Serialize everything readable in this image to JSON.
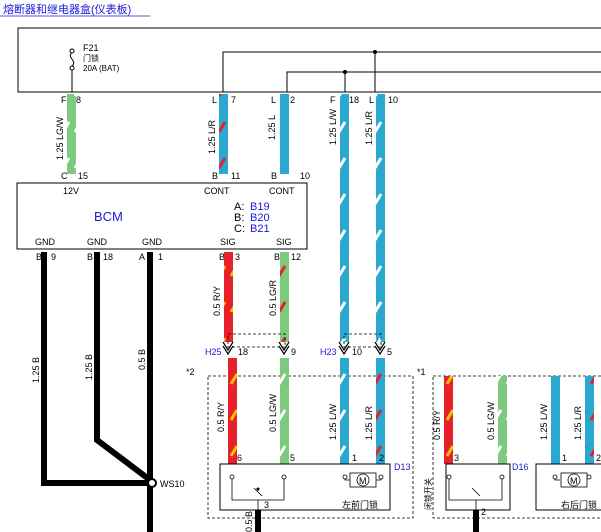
{
  "header": {
    "title": "熔断器和继电器盒(仪表板)"
  },
  "fuse": {
    "id": "F21",
    "name": "门锁",
    "rating": "20A (BAT)"
  },
  "connectors_top": [
    {
      "name": "conn-f8",
      "letter": "F",
      "pin": "8"
    },
    {
      "name": "conn-l7",
      "letter": "L",
      "pin": "7"
    },
    {
      "name": "conn-l2",
      "letter": "L",
      "pin": "2"
    },
    {
      "name": "conn-f18",
      "letter": "F",
      "pin": "18"
    },
    {
      "name": "conn-l10",
      "letter": "L",
      "pin": "10"
    }
  ],
  "wires_upper": [
    {
      "name": "wire-lgw-upper",
      "label": "1.25 LG/W",
      "color": "#7dc97d",
      "stripe": "#ffffff"
    },
    {
      "name": "wire-lr-upper",
      "label": "1.25 L/R",
      "color": "#2aa8d0",
      "stripe": "#e8202a"
    },
    {
      "name": "wire-l-upper",
      "label": "1.25 L",
      "color": "#2aa8d0",
      "stripe": ""
    },
    {
      "name": "wire-lw-upper",
      "label": "1.25 L/W",
      "color": "#2aa8d0",
      "stripe": "#ffffff"
    },
    {
      "name": "wire-lr2-upper",
      "label": "1.25 L/R",
      "color": "#2aa8d0",
      "stripe": "#ffffff"
    }
  ],
  "bcm": {
    "label": "BCM",
    "pin_12v": {
      "letter": "C",
      "pin": "15",
      "text": "12V"
    },
    "pin_cont1": {
      "letter": "B",
      "pin": "11",
      "text": "CONT"
    },
    "pin_cont2": {
      "letter": "B",
      "pin": "10",
      "text": "CONT"
    },
    "legend": [
      {
        "key": "A:",
        "val": "B19"
      },
      {
        "key": "B:",
        "val": "B20"
      },
      {
        "key": "C:",
        "val": "B21"
      }
    ],
    "bottom_pins": [
      {
        "name": "bcm-gnd-b9",
        "text": "GND",
        "letter": "B",
        "pin": "9"
      },
      {
        "name": "bcm-gnd-b18",
        "text": "GND",
        "letter": "B",
        "pin": "18"
      },
      {
        "name": "bcm-gnd-a1",
        "text": "GND",
        "letter": "A",
        "pin": "1"
      },
      {
        "name": "bcm-sig-b3",
        "text": "SIG",
        "letter": "B",
        "pin": "3"
      },
      {
        "name": "bcm-sig-b12",
        "text": "SIG",
        "letter": "B",
        "pin": "12"
      }
    ]
  },
  "wires_gnd": [
    {
      "name": "wire-gnd-1",
      "label": "1.25 B"
    },
    {
      "name": "wire-gnd-2",
      "label": "1.25 B"
    },
    {
      "name": "wire-gnd-3",
      "label": "0.5 B"
    }
  ],
  "wires_sig": [
    {
      "name": "wire-ry-mid",
      "label": "0.5 R/Y",
      "color": "#e8202a",
      "stripe": "#f5c400"
    },
    {
      "name": "wire-lgr-mid",
      "label": "0.5 LG/R",
      "color": "#7dc97d",
      "stripe": "#e8202a"
    }
  ],
  "inline_connectors": {
    "h25": {
      "id": "H25",
      "pins": [
        "18",
        "9"
      ]
    },
    "h23": {
      "id": "H23",
      "pins": [
        "10",
        "5"
      ]
    }
  },
  "ground_point": "WS10",
  "group2": {
    "marker": "*2",
    "wires": [
      {
        "name": "wire-g2-ry",
        "label": "0.5 R/Y",
        "color": "#e8202a",
        "stripe": "#f5c400"
      },
      {
        "name": "wire-g2-lgw",
        "label": "0.5 LG/W",
        "color": "#7dc97d",
        "stripe": "#ffffff"
      },
      {
        "name": "wire-g2-lw",
        "label": "1.25 L/W",
        "color": "#2aa8d0",
        "stripe": "#ffffff"
      },
      {
        "name": "wire-g2-lr",
        "label": "1.25 L/R",
        "color": "#2aa8d0",
        "stripe": "#e8202a"
      }
    ],
    "pins": [
      "6",
      "5",
      "1",
      "2"
    ],
    "bottom_pin": "3",
    "connector": "D13",
    "motor": "M",
    "caption": "左前门锁",
    "gnd_label": "0.5 B"
  },
  "group1": {
    "marker": "*1",
    "wires": [
      {
        "name": "wire-g1-ry",
        "label": "0.5 R/Y",
        "color": "#e8202a",
        "stripe": "#f5c400"
      },
      {
        "name": "wire-g1-lgw",
        "label": "0.5 LG/W",
        "color": "#7dc97d",
        "stripe": "#ffffff"
      },
      {
        "name": "wire-g1-lw",
        "label": "1.25 L/W",
        "color": "#2aa8d0",
        "stripe": "#ffffff"
      },
      {
        "name": "wire-g1-lr",
        "label": "1.25 L/R",
        "color": "#2aa8d0",
        "stripe": "#e8202a"
      }
    ],
    "pins": [
      "3",
      "1",
      "2"
    ],
    "bottom_pin": "2",
    "connector": "D16",
    "switch_caption": "闭锁开关",
    "motor": "M",
    "caption": "右后门锁"
  }
}
